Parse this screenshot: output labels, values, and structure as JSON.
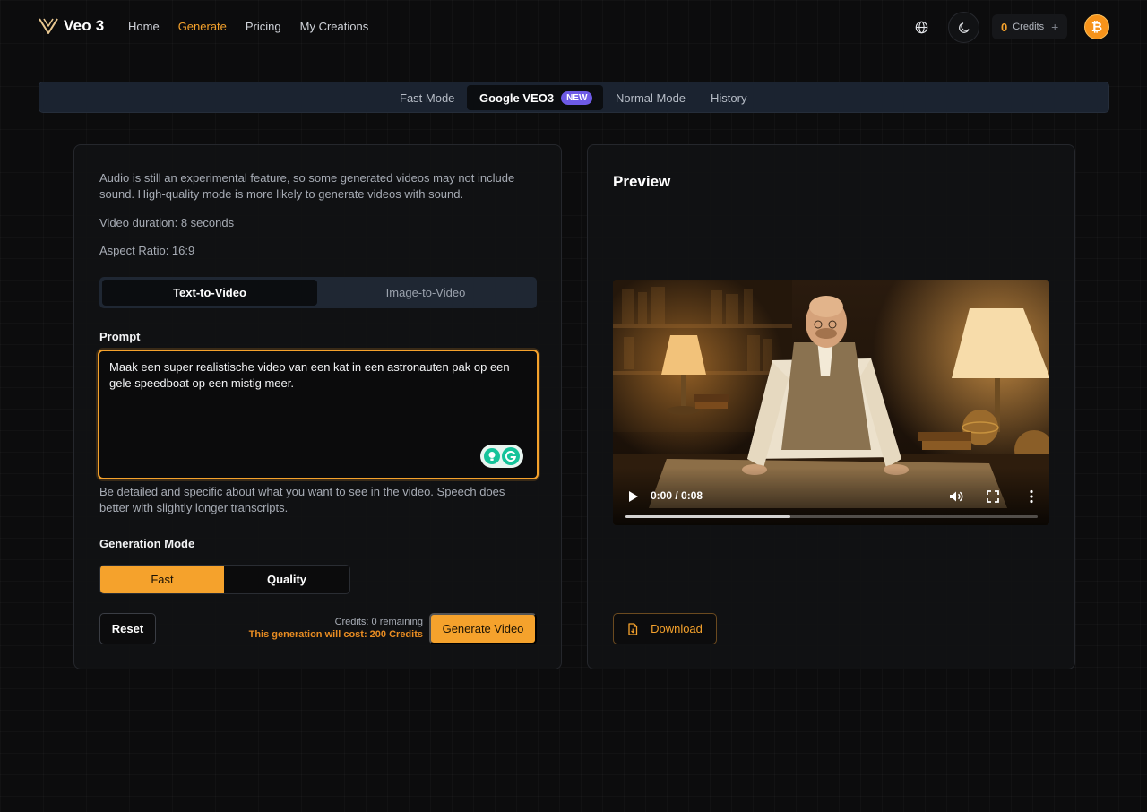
{
  "header": {
    "logo_text": "Veo 3",
    "nav": [
      {
        "label": "Home",
        "active": false
      },
      {
        "label": "Generate",
        "active": true
      },
      {
        "label": "Pricing",
        "active": false
      },
      {
        "label": "My Creations",
        "active": false
      }
    ],
    "credits_count": "0",
    "credits_label": "Credits",
    "credits_plus": "+",
    "avatar_glyph": "₿",
    "icons": [
      "globe-icon",
      "moon-icon",
      "plus-icon",
      "bitcoin-icon"
    ]
  },
  "modes": {
    "tabs": [
      {
        "label": "Fast Mode"
      },
      {
        "label": "Google VEO3",
        "badge": "NEW",
        "active": true
      },
      {
        "label": "Normal Mode"
      },
      {
        "label": "History"
      }
    ]
  },
  "form": {
    "info_audio": "Audio is still an experimental feature, so some generated videos may not include sound. High-quality mode is more likely to generate videos with sound.",
    "info_duration": "Video duration: 8 seconds",
    "info_aspect": "Aspect Ratio: 16:9",
    "input_types": [
      "Text-to-Video",
      "Image-to-Video"
    ],
    "selected_input_type": "Text-to-Video",
    "prompt_label": "Prompt",
    "prompt_value": "Maak een super realistische video van een kat in een astronauten pak op een gele speedboat op een mistig meer.",
    "prompt_hint": "Be detailed and specific about what you want to see in the video. Speech does better with slightly longer transcripts.",
    "generation_mode_label": "Generation Mode",
    "generation_modes": [
      "Fast",
      "Quality"
    ],
    "selected_generation_mode": "Fast",
    "reset_label": "Reset",
    "credits_remaining": "Credits: 0 remaining",
    "cost_text": "This generation will cost: 200 Credits",
    "generate_label": "Generate Video"
  },
  "preview": {
    "title": "Preview",
    "time_display": "0:00 / 0:08",
    "buffered_fraction": 0.4,
    "download_label": "Download"
  },
  "colors": {
    "accent": "#f5a22c",
    "badge": "#6d5ae6",
    "background": "#0c0c0d"
  }
}
